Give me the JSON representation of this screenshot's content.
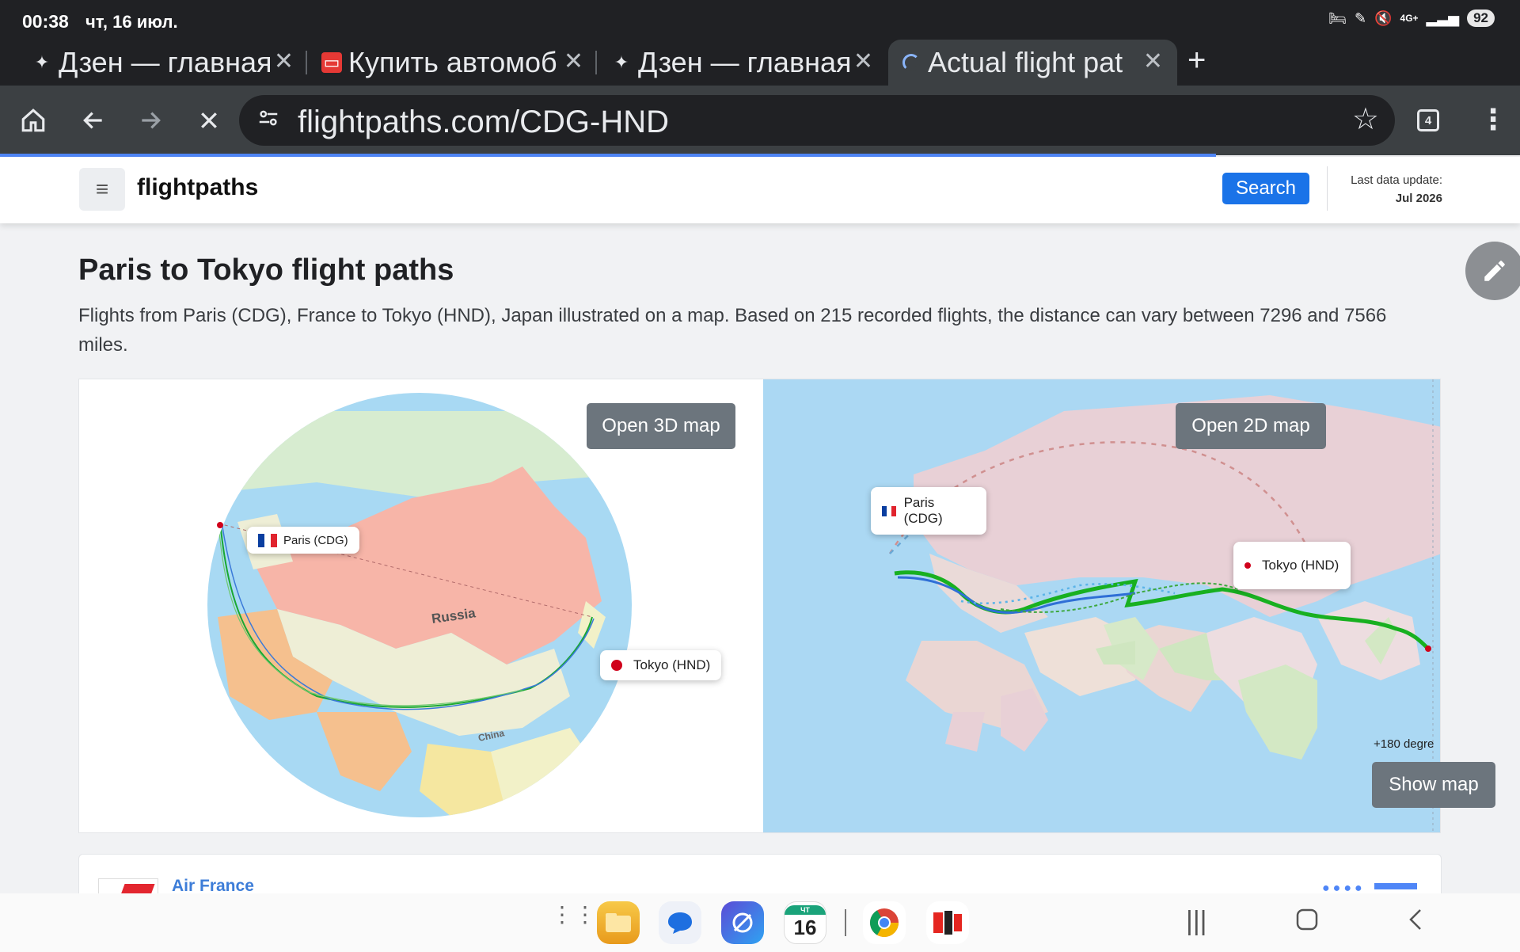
{
  "status_bar": {
    "time": "00:38",
    "date": "чт, 16 июл.",
    "battery": "92",
    "network": "4G+"
  },
  "tabs": [
    {
      "title": "Дзен — главная",
      "favicon": "sparkle-icon"
    },
    {
      "title": "Купить автомоб",
      "favicon": "car-icon"
    },
    {
      "title": "Дзен — главная",
      "favicon": "sparkle-icon"
    },
    {
      "title": "Actual flight pat",
      "favicon": "loading-spinner-icon"
    }
  ],
  "toolbar": {
    "url": "flightpaths.com/CDG-HND",
    "tab_count": "4"
  },
  "page_load_progress": 0.8,
  "site": {
    "logo": "flightpaths",
    "search_label": "Search",
    "last_update_label": "Last data update:",
    "last_update_value": "Jul 2026"
  },
  "content": {
    "title": "Paris to Tokyo flight paths",
    "description": "Flights from Paris (CDG), France to Tokyo (HND), Japan illustrated on a map. Based on 215 recorded flights, the distance can vary between 7296 and 7566 miles."
  },
  "map3d": {
    "button_label": "Open 3D map",
    "origin_label": "Paris (CDG)",
    "destination_label": "Tokyo (HND)",
    "country_labels": [
      "Russia",
      "China"
    ]
  },
  "map2d": {
    "button_label": "Open 2D map",
    "origin_label": "Paris (CDG)",
    "destination_label": "Tokyo (HND)",
    "degree_label": "+180 degre"
  },
  "show_map_label": "Show map",
  "airline": {
    "name": "Air France"
  },
  "dock": {
    "calendar_day": "16",
    "calendar_weekday": "ЧТ"
  },
  "colors": {
    "accent_blue": "#1a73e8",
    "route_green": "#18b020",
    "map_button_gray": "#6c757d"
  }
}
